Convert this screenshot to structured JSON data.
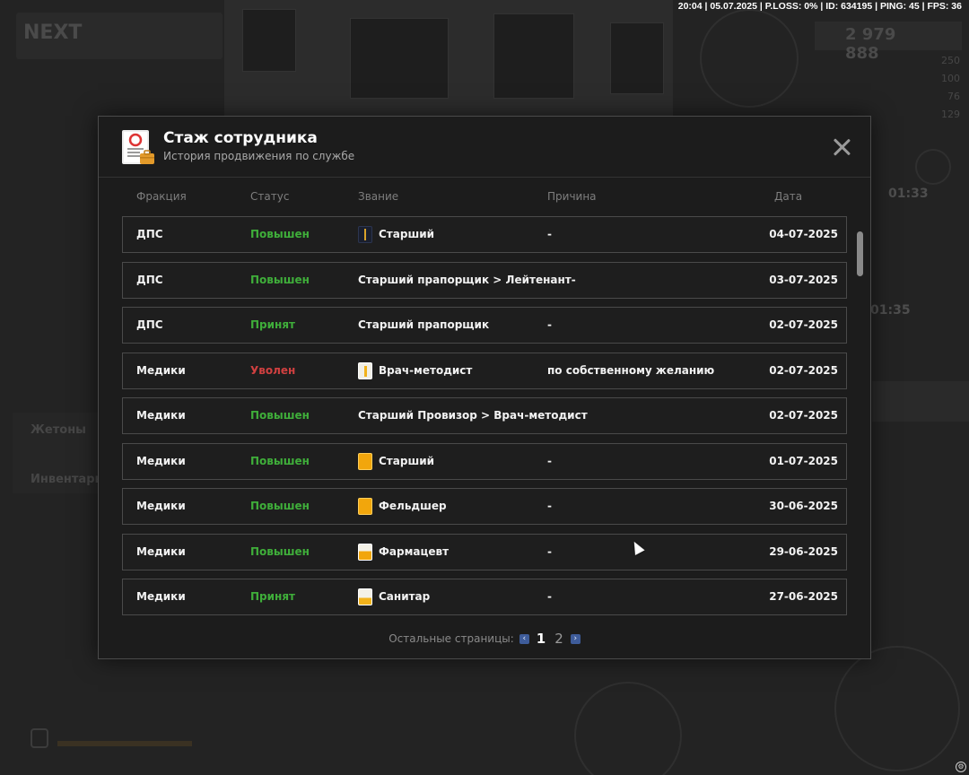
{
  "status_bar": "20:04 | 05.07.2025 | P.LOSS: 0% | ID: 634195 | PING: 45 | FPS: 36",
  "background": {
    "logo_text": "NEXT",
    "money": "2 979 888",
    "stats": [
      "250",
      "100",
      "76",
      "129"
    ],
    "timer1": "01:33",
    "timer2": "01:35",
    "side_label1": "Жетоны",
    "side_label2": "Инвентарь"
  },
  "modal": {
    "title": "Стаж сотрудника",
    "subtitle": "История продвижения по службе",
    "columns": {
      "faction": "Фракция",
      "status": "Статус",
      "rank": "Звание",
      "reason": "Причина",
      "date": "Дата"
    },
    "rows": [
      {
        "faction": "ДПС",
        "status": "Повышен",
        "status_kind": "green",
        "rank": "Старший",
        "rank_icon": "dps-stripe-icon",
        "reason": "-",
        "date": "04-07-2025"
      },
      {
        "faction": "ДПС",
        "status": "Повышен",
        "status_kind": "green",
        "rank": "Старший прапорщик > Лейтенант-",
        "rank_icon": "",
        "reason": "",
        "date": "03-07-2025"
      },
      {
        "faction": "ДПС",
        "status": "Принят",
        "status_kind": "green",
        "rank": "Старший прапорщик",
        "rank_icon": "",
        "reason": "-",
        "date": "02-07-2025"
      },
      {
        "faction": "Медики",
        "status": "Уволен",
        "status_kind": "red",
        "rank": "Врач-методист",
        "rank_icon": "white-stripe-icon",
        "reason": "по собственному желанию",
        "date": "02-07-2025"
      },
      {
        "faction": "Медики",
        "status": "Повышен",
        "status_kind": "green",
        "rank": "Старший Провизор > Врач-методист",
        "rank_icon": "",
        "reason": "",
        "date": "02-07-2025"
      },
      {
        "faction": "Медики",
        "status": "Повышен",
        "status_kind": "green",
        "rank": "Старший",
        "rank_icon": "orange-full-icon",
        "reason": "-",
        "date": "01-07-2025"
      },
      {
        "faction": "Медики",
        "status": "Повышен",
        "status_kind": "green",
        "rank": "Фельдшер",
        "rank_icon": "orange-full-icon",
        "reason": "-",
        "date": "30-06-2025"
      },
      {
        "faction": "Медики",
        "status": "Повышен",
        "status_kind": "green",
        "rank": "Фармацевт",
        "rank_icon": "orange-half-icon",
        "reason": "-",
        "date": "29-06-2025"
      },
      {
        "faction": "Медики",
        "status": "Принят",
        "status_kind": "green",
        "rank": "Санитар",
        "rank_icon": "orange-third-icon",
        "reason": "-",
        "date": "27-06-2025"
      }
    ],
    "pager": {
      "label": "Остальные страницы:",
      "pages": [
        "1",
        "2"
      ],
      "current": "1"
    }
  },
  "colors": {
    "status_green": "#3fae3a",
    "status_red": "#d04040",
    "pager_arrow": "#3e5c9a"
  }
}
